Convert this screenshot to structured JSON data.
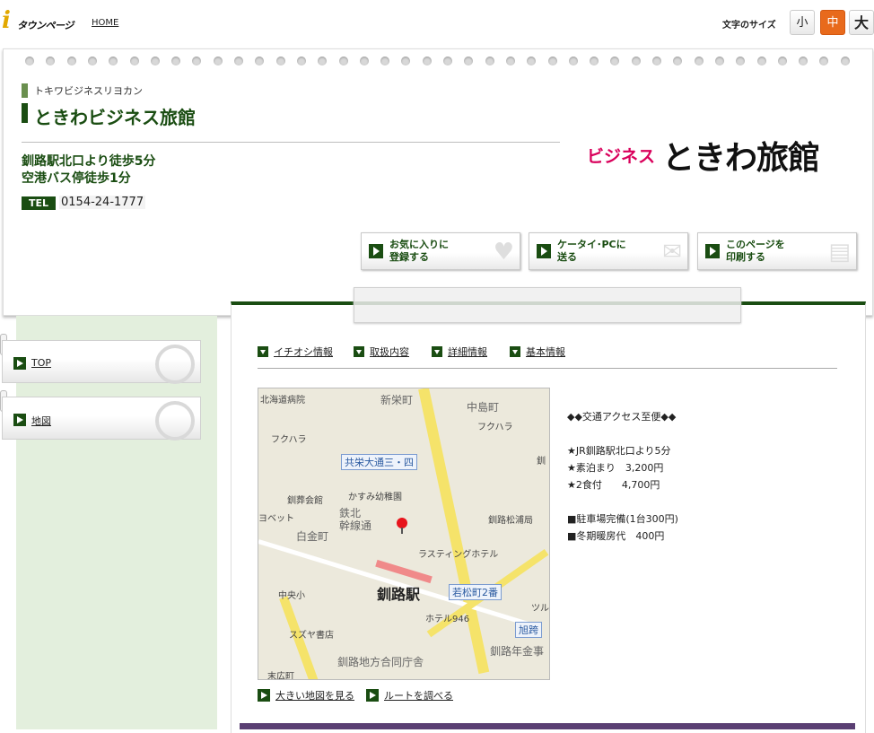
{
  "topbar": {
    "logo_glyph": "i",
    "logo_text": "タウンページ",
    "home_label": "HOME",
    "font_size_label": "文字のサイズ",
    "font_sizes": [
      "小",
      "中",
      "大"
    ]
  },
  "header": {
    "kana_name": "トキワビジネスリヨカン",
    "name": "ときわビジネス旅館",
    "access_lines": [
      "釧路駅北口より徒歩5分",
      "空港バス停徒歩1分"
    ],
    "tel_label": "TEL",
    "tel_number": "0154-24-1777",
    "brand_prefix": "ビジネス",
    "brand_name": "ときわ旅館",
    "actions": [
      {
        "label_line1": "お気に入りに",
        "label_line2": "登録する",
        "icon": "heart-icon"
      },
      {
        "label_line1": "ケータイ･PCに",
        "label_line2": "送る",
        "icon": "mail-icon"
      },
      {
        "label_line1": "このページを",
        "label_line2": "印刷する",
        "icon": "printer-icon"
      }
    ]
  },
  "sidebar": {
    "items": [
      {
        "label": "TOP",
        "icon": "home-icon"
      },
      {
        "label": "地図",
        "icon": "map-icon"
      }
    ]
  },
  "tabs": [
    "イチオシ情報",
    "取扱内容",
    "詳細情報",
    "基本情報"
  ],
  "map": {
    "labels": {
      "hospital": "北海道病院",
      "shinsakae": "新栄町",
      "nakajima": "中島町",
      "fukuhara1": "フクハラ",
      "fukuhara2": "フクハラ",
      "intersection": "共栄大通三・四",
      "kushiro_right": "釧",
      "hall": "釧葬会館",
      "kindergarten": "かすみ幼稚園",
      "tetsuhoku": "鉄北",
      "kansen": "幹線通",
      "post": "釧路松浦局",
      "yobetto": "ヨベット",
      "shiroganecho": "白金町",
      "rusting": "ラスティングホテル",
      "chuosho": "中央小",
      "station": "釧路駅",
      "wakamatsu": "若松町2番",
      "tsuru": "ツル",
      "hotel946": "ホテル946",
      "asahi": "旭跨",
      "suzuya": "スズヤ書店",
      "nenkin": "釧路年金事",
      "godo": "釧路地方合同庁舎",
      "suehiro": "末広町"
    }
  },
  "map_links": [
    "大きい地図を見る",
    "ルートを調べる"
  ],
  "info": {
    "lines": [
      "◆◆交通アクセス至便◆◆",
      "",
      "★JR釧路駅北口より5分",
      "★素泊まり　3,200円",
      "★2食付　　4,700円",
      "",
      "■駐車場完備(1台300円)",
      "■冬期暖房代　400円"
    ]
  },
  "colors": {
    "primary_green": "#1a4d12",
    "brand_pink": "#d9005b",
    "font_size_active": "#e86a1c",
    "sidebar_bg": "#e3efdd",
    "footer_band": "#5a3f73"
  }
}
